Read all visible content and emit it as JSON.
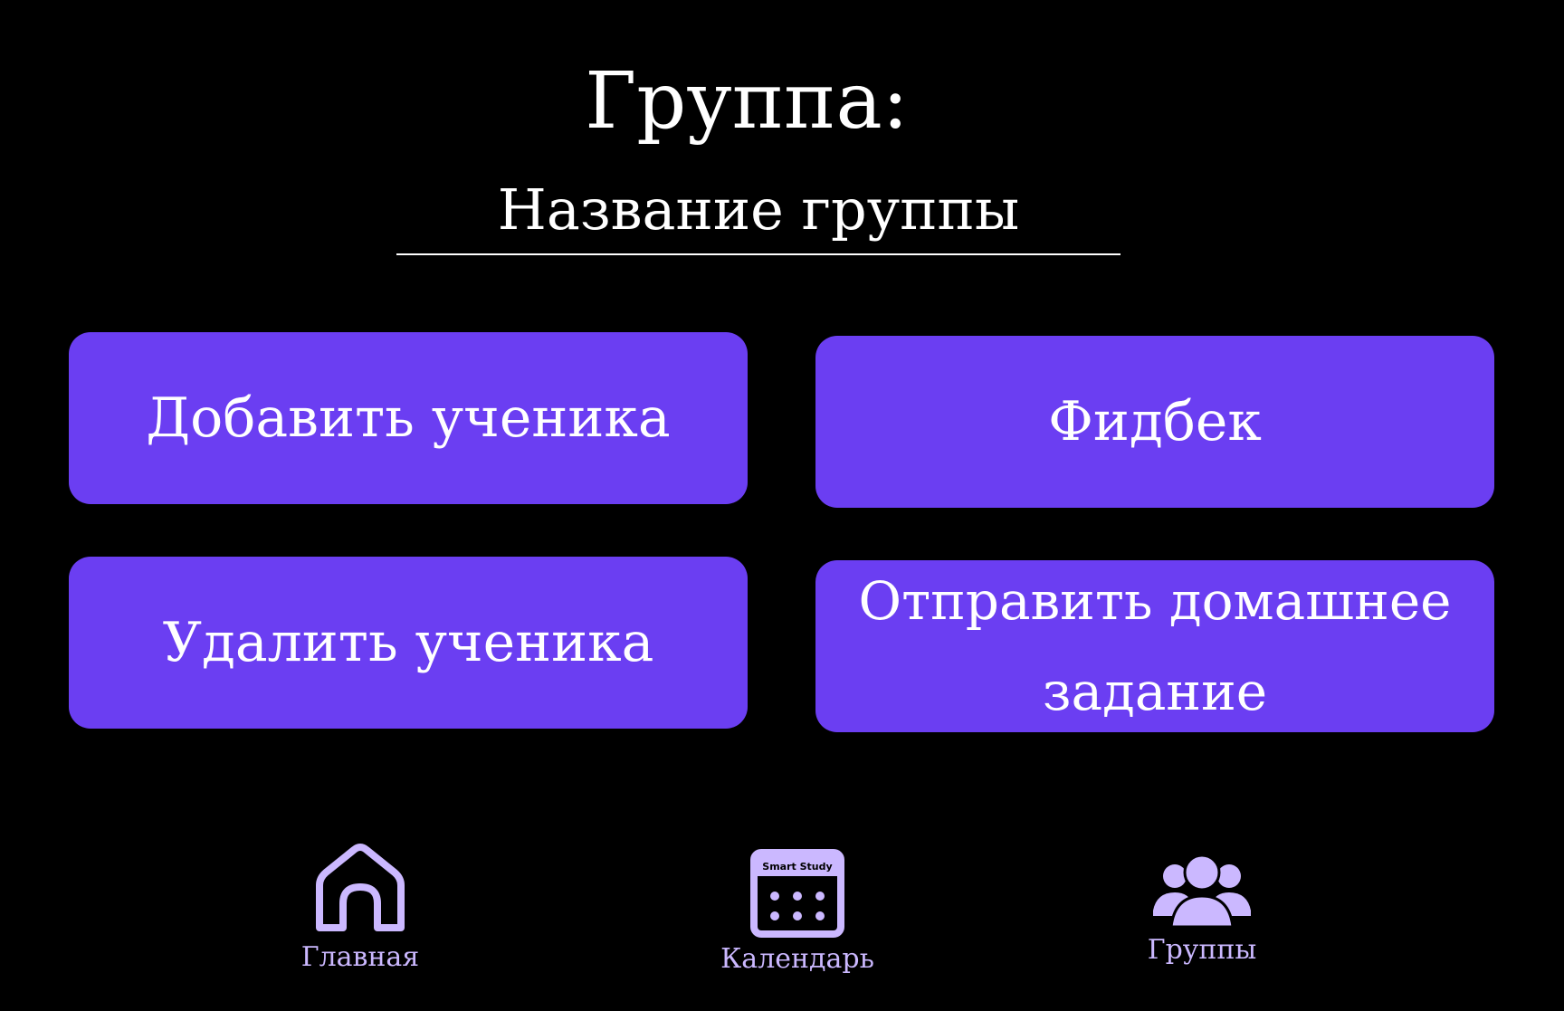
{
  "header": {
    "title": "Группа:",
    "group_name": "Название группы"
  },
  "actions": {
    "add_student": "Добавить ученика",
    "feedback": "Фидбек",
    "remove_student": "Удалить ученика",
    "send_homework": "Отправить домашнее задание"
  },
  "nav": {
    "home": {
      "label": "Главная",
      "icon": "home-icon"
    },
    "calendar": {
      "label": "Календарь",
      "icon": "calendar-icon",
      "badge_text": "Smart Study"
    },
    "groups": {
      "label": "Группы",
      "icon": "group-icon"
    }
  },
  "colors": {
    "background": "#000000",
    "button": "#6b3ef2",
    "nav_icon": "#cbb8ff",
    "text": "#ffffff"
  }
}
